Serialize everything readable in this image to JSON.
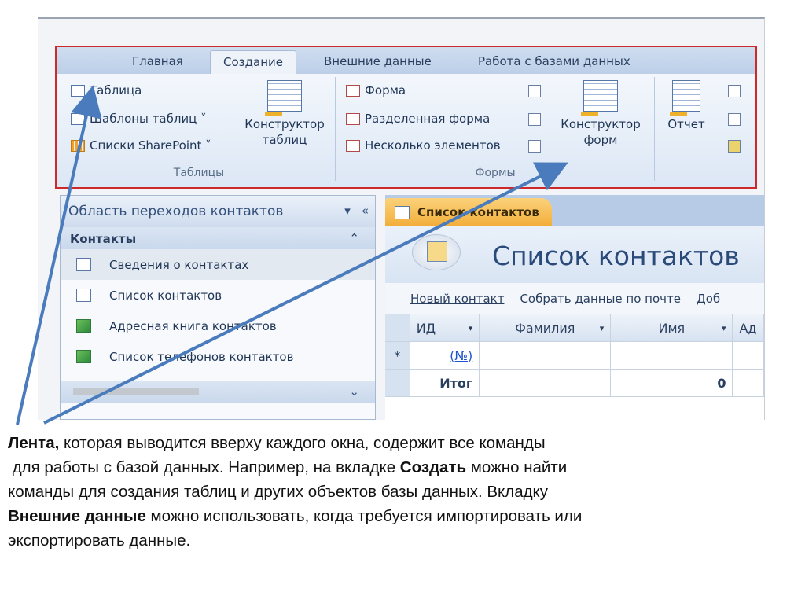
{
  "ribbon": {
    "tabs": [
      "Главная",
      "Создание",
      "Внешние данные",
      "Работа с базами данных"
    ],
    "active_tab_index": 1,
    "tables_group": {
      "label": "Таблицы",
      "items": [
        "Таблица",
        "Шаблоны таблиц ˅",
        "Списки SharePoint ˅"
      ],
      "designer": [
        "Конструктор",
        "таблиц"
      ]
    },
    "forms_group": {
      "label": "Формы",
      "items": [
        "Форма",
        "Разделенная форма",
        "Несколько элементов"
      ],
      "designer": [
        "Конструктор",
        "форм"
      ]
    },
    "reports_group": {
      "report_label": "Отчет"
    }
  },
  "nav_pane": {
    "title": "Область переходов контактов",
    "section": "Контакты",
    "items": [
      "Сведения о контактах",
      "Список контактов",
      "Адресная книга контактов",
      "Список телефонов контактов"
    ],
    "selected_index": 0
  },
  "document": {
    "tab_label": "Список контактов",
    "form_title": "Список контактов",
    "links": [
      "Новый контакт",
      "Собрать данные по почте",
      "Доб"
    ],
    "columns": [
      "ИД",
      "Фамилия",
      "Имя",
      "Ад"
    ],
    "new_row_marker": "*",
    "new_row_id": "(№)",
    "total_label": "Итог",
    "total_value": "0"
  },
  "caption": {
    "p1_bold": "Лента,",
    "p1": " которая выводится вверху каждого окна, содержит все команды",
    "p2": "для работы с базой данных. Например, на вкладке ",
    "p2_bold": "Создать",
    "p2_end": " можно найти",
    "p3": "команды для создания таблиц и других объектов базы данных. Вкладку",
    "p4_bold": "Внешние данные",
    "p4": " можно использовать, когда требуется импортировать или",
    "p5": "экспортировать данные."
  },
  "colors": {
    "highlight_border": "#cc2a2a",
    "arrow": "#4a7bbd",
    "doc_tab": "#f2ad3a"
  }
}
